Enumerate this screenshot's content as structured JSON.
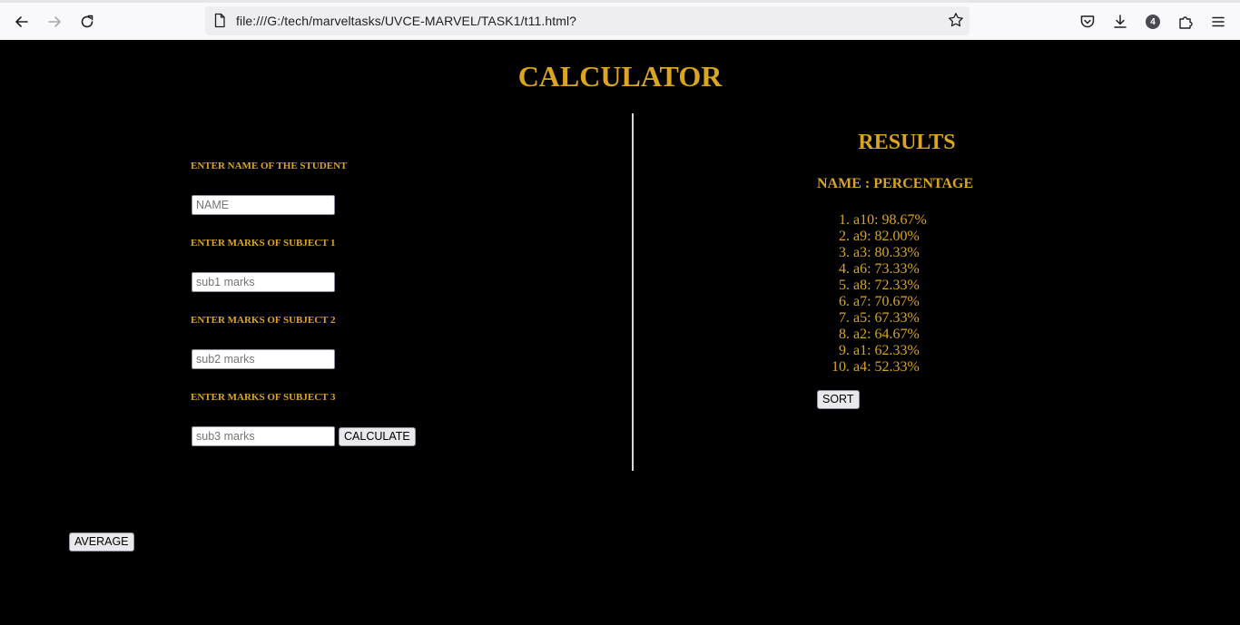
{
  "browser": {
    "url": "file:///G:/tech/marveltasks/UVCE-MARVEL/TASK1/t11.html?",
    "extensions_badge": "4"
  },
  "page": {
    "title": "CALCULATOR",
    "form": {
      "name_label": "ENTER NAME OF THE STUDENT",
      "name_placeholder": "NAME",
      "name_value": "",
      "sub1_label": "ENTER MARKS OF SUBJECT 1",
      "sub1_placeholder": "sub1 marks",
      "sub1_value": "",
      "sub2_label": "ENTER MARKS OF SUBJECT 2",
      "sub2_placeholder": "sub2 marks",
      "sub2_value": "",
      "sub3_label": "ENTER MARKS OF SUBJECT 3",
      "sub3_placeholder": "sub3 marks",
      "sub3_value": "",
      "calculate_label": "CALCULATE"
    },
    "results": {
      "heading": "RESULTS",
      "subheading": "NAME : PERCENTAGE",
      "items": [
        "a10: 98.67%",
        "a9: 82.00%",
        "a3: 80.33%",
        "a6: 73.33%",
        "a8: 72.33%",
        "a7: 70.67%",
        "a5: 67.33%",
        "a2: 64.67%",
        "a1: 62.33%",
        "a4: 52.33%"
      ],
      "sort_label": "SORT"
    },
    "average_label": "AVERAGE"
  },
  "colors": {
    "background": "#000000",
    "accent": "#daa520",
    "divider": "#d8d8d8"
  },
  "icons": {
    "back": "arrow-left-icon",
    "forward": "arrow-right-icon",
    "reload": "reload-icon",
    "page": "page-icon",
    "bookmark": "star-icon",
    "pocket": "pocket-icon",
    "downloads": "download-icon",
    "extensions": "puzzle-icon",
    "menu": "hamburger-menu-icon"
  }
}
